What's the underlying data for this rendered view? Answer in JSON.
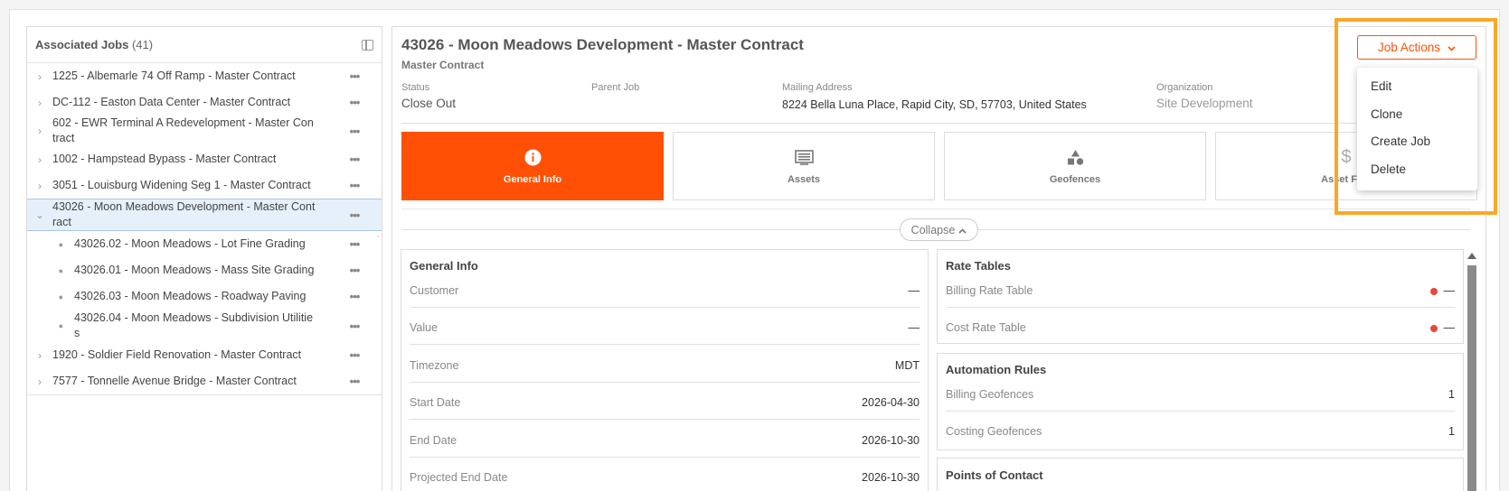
{
  "sidebar": {
    "title": "Associated Jobs",
    "count": "(41)",
    "items": [
      {
        "label": "1225 - Albemarle 74 Off Ramp - Master Contract"
      },
      {
        "label": "DC-112 - Easton Data Center - Master Contract"
      },
      {
        "label_line1": "602 - EWR Terminal A Redevelopment - Master Con",
        "label_line2": "tract"
      },
      {
        "label": "1002 - Hampstead Bypass - Master Contract"
      },
      {
        "label": "3051 - Louisburg Widening Seg 1 - Master Contract"
      },
      {
        "label_line1": "43026 - Moon Meadows Development - Master Cont",
        "label_line2": "ract"
      },
      {
        "label": "43026.02 - Moon Meadows - Lot Fine Grading"
      },
      {
        "label": "43026.01 - Moon Meadows - Mass Site Grading"
      },
      {
        "label": "43026.03 - Moon Meadows - Roadway Paving"
      },
      {
        "label_line1": "43026.04 - Moon Meadows - Subdivision Utilitie",
        "label_line2": "s"
      },
      {
        "label": "1920 - Soldier Field Renovation - Master Contract"
      },
      {
        "label": "7577 - Tonnelle Avenue Bridge - Master Contract"
      }
    ]
  },
  "job": {
    "title": "43026 - Moon Meadows Development - Master Contract",
    "subtitle": "Master Contract",
    "status_label": "Status",
    "status_value": "Close Out",
    "parent_label": "Parent Job",
    "mailing_label": "Mailing Address",
    "mailing_value": "8224 Bella Luna Place, Rapid City, SD, 57703, United States",
    "org_label": "Organization",
    "org_value": "Site Development"
  },
  "tabs": [
    {
      "label": "General Info",
      "icon": "info-icon"
    },
    {
      "label": "Assets",
      "icon": "list-icon"
    },
    {
      "label": "Geofences",
      "icon": "shapes-icon"
    },
    {
      "label": "Asset Fina",
      "icon": "dollar-icon"
    }
  ],
  "collapse_label": "Collapse",
  "general_info": {
    "title": "General Info",
    "rows": [
      {
        "label": "Customer",
        "value": "—"
      },
      {
        "label": "Value",
        "value": "—"
      },
      {
        "label": "Timezone",
        "value": "MDT"
      },
      {
        "label": "Start Date",
        "value": "2026-04-30"
      },
      {
        "label": "End Date",
        "value": "2026-10-30"
      },
      {
        "label": "Projected End Date",
        "value": "2026-10-30"
      }
    ]
  },
  "rate_tables": {
    "title": "Rate Tables",
    "rows": [
      {
        "label": "Billing Rate Table",
        "value": "—"
      },
      {
        "label": "Cost Rate Table",
        "value": "—"
      }
    ]
  },
  "automation_rules": {
    "title": "Automation Rules",
    "rows": [
      {
        "label": "Billing Geofences",
        "value": "1"
      },
      {
        "label": "Costing Geofences",
        "value": "1"
      }
    ]
  },
  "points_of_contact": {
    "title": "Points of Contact"
  },
  "actions": {
    "button_label": "Job Actions",
    "menu": [
      "Edit",
      "Clone",
      "Create Job",
      "Delete"
    ]
  },
  "colors": {
    "accent": "#ff5005",
    "highlight": "#f9a825",
    "selected_row": "#e6f0fb",
    "status_dot": "#e8473b"
  }
}
